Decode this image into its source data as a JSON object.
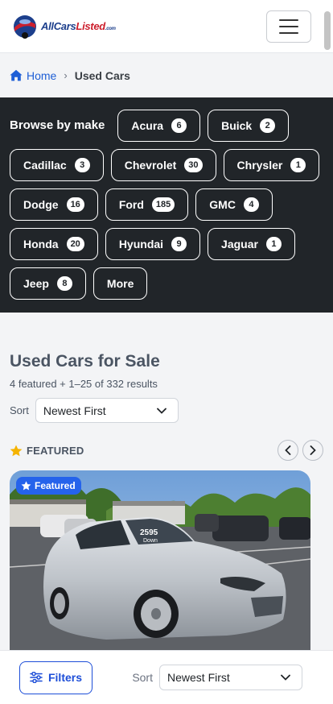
{
  "header": {
    "logo_part1": "AllCars",
    "logo_part2": "Listed",
    "logo_part3": ".com"
  },
  "breadcrumb": {
    "home": "Home",
    "separator": "›",
    "current": "Used Cars"
  },
  "makes": {
    "title": "Browse by make",
    "items": [
      {
        "label": "Acura",
        "count": "6"
      },
      {
        "label": "Buick",
        "count": "2"
      },
      {
        "label": "Cadillac",
        "count": "3"
      },
      {
        "label": "Chevrolet",
        "count": "30"
      },
      {
        "label": "Chrysler",
        "count": "1"
      },
      {
        "label": "Dodge",
        "count": "16"
      },
      {
        "label": "Ford",
        "count": "185"
      },
      {
        "label": "GMC",
        "count": "4"
      },
      {
        "label": "Honda",
        "count": "20"
      },
      {
        "label": "Hyundai",
        "count": "9"
      },
      {
        "label": "Jaguar",
        "count": "1"
      },
      {
        "label": "Jeep",
        "count": "8"
      }
    ],
    "more_label": "More"
  },
  "results": {
    "title": "Used Cars for Sale",
    "count_text": "4 featured + 1–25 of 332 results",
    "sort_label": "Sort",
    "sort_value": "Newest First",
    "featured_heading": "FEATURED",
    "card_badge": "Featured",
    "windshield_text_1": "2595",
    "windshield_text_2": "Down"
  },
  "bottom_bar": {
    "filters_label": "Filters",
    "sort_label": "Sort",
    "sort_value": "Newest First"
  },
  "colors": {
    "dark_section": "#212529",
    "accent_blue": "#2563eb",
    "link_blue": "#1f5fd6",
    "star": "#f5b301"
  }
}
